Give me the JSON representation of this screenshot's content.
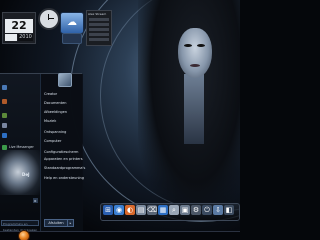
{
  "gadgets": {
    "calendar": {
      "day": "",
      "date": "22",
      "month": "",
      "year": "2010"
    },
    "feed_header": "Alex Stream",
    "mini_label": ""
  },
  "start_menu": {
    "right_items": [
      "Creator",
      "Documenten",
      "Afbeeldingen",
      "Muziek",
      "Ontspanning",
      "Computer",
      "Configuratiescherm",
      "Apparaten en printers",
      "Standaardprogramma's",
      "Help en ondersteuning"
    ],
    "pinned_items": [
      "",
      "",
      "",
      "",
      "",
      "",
      "",
      "Live Messenger"
    ],
    "dj_label": "DeJ",
    "search_placeholder": "Programma's en bestanden doorzoeken",
    "shutdown_label": "Afsluiten",
    "shutdown_arrow": "▸",
    "all_programs_arrow": "▸"
  },
  "dock": {
    "icons": [
      {
        "name": "windows-icon",
        "glyph": "⊞",
        "color": "#2a5fb0"
      },
      {
        "name": "globe-icon",
        "glyph": "◉",
        "color": "#3b7fd1"
      },
      {
        "name": "firefox-icon",
        "glyph": "◐",
        "color": "#d9692b"
      },
      {
        "name": "notes-icon",
        "glyph": "▤",
        "color": "#7c8b9e"
      },
      {
        "name": "trash-icon",
        "glyph": "⌫",
        "color": "#5a6677"
      },
      {
        "name": "network-icon",
        "glyph": "▦",
        "color": "#2d6fc4"
      },
      {
        "name": "search-icon",
        "glyph": "⌕",
        "color": "#9aa7b7"
      },
      {
        "name": "photo-icon",
        "glyph": "▣",
        "color": "#6b7a8d"
      },
      {
        "name": "settings-icon",
        "glyph": "⚙",
        "color": "#4b5666"
      },
      {
        "name": "power-icon",
        "glyph": "⏻",
        "color": "#3a4a60"
      },
      {
        "name": "download-icon",
        "glyph": "⇩",
        "color": "#5a7aa3"
      },
      {
        "name": "bag-icon",
        "glyph": "◧",
        "color": "#3c4b5f"
      }
    ]
  },
  "colors": {
    "orb": "#e8821f",
    "accent": "#3b7fd1",
    "menu_bg": "#06090e"
  }
}
